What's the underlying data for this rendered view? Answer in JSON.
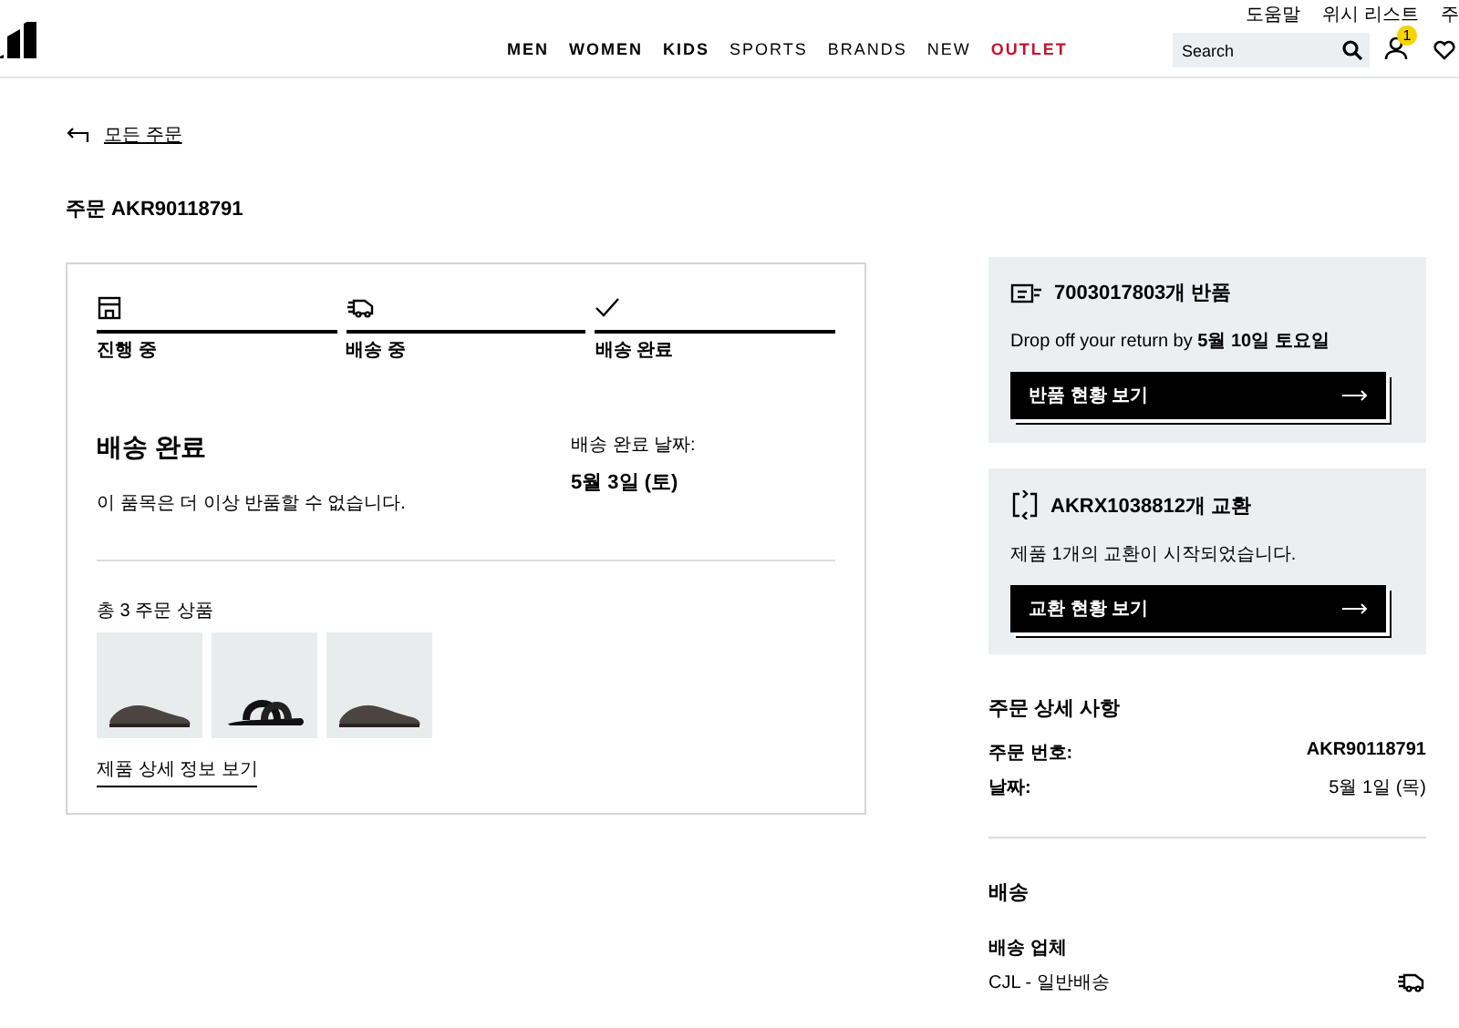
{
  "header": {
    "utility_links": [
      "도움말",
      "위시 리스트",
      "주"
    ],
    "nav": [
      {
        "label": "MEN",
        "kind": "bold"
      },
      {
        "label": "WOMEN",
        "kind": "bold"
      },
      {
        "label": "KIDS",
        "kind": "bold"
      },
      {
        "label": "SPORTS",
        "kind": "regular"
      },
      {
        "label": "BRANDS",
        "kind": "regular"
      },
      {
        "label": "NEW",
        "kind": "regular"
      },
      {
        "label": "OUTLET",
        "kind": "sale"
      }
    ],
    "search": {
      "placeholder": "Search"
    },
    "account_badge": "1"
  },
  "back_link": "모든 주문",
  "order_title": "주문 AKR90118791",
  "tracker": {
    "steps": [
      {
        "label": "진행 중",
        "completed": true
      },
      {
        "label": "배송 중",
        "completed": true
      },
      {
        "label": "배송 완료",
        "completed": true
      }
    ],
    "status": "배송 완료",
    "status_note": "이 품목은 더 이상 반품할 수 없습니다.",
    "date_label": "배송 완료 날짜:",
    "date": "5월 3일 (토)",
    "items_label": "총 3 주문 상품",
    "products": [
      {
        "kind": "sneaker"
      },
      {
        "kind": "slide"
      },
      {
        "kind": "sneaker"
      }
    ],
    "details_link": "제품 상세 정보 보기"
  },
  "panels": [
    {
      "title": "7003017803개 반품",
      "text": "Drop off your return by **5월 10일 토요일**",
      "button": "반품 현황 보기"
    },
    {
      "title": "AKRX1038812개 교환",
      "text": "제품 1개의 교환이 시작되었습니다.",
      "button": "교환 현황 보기"
    }
  ],
  "order_details": {
    "title": "주문 상세 사항",
    "rows": [
      {
        "label": "주문 번호:",
        "value": "AKR90118791"
      },
      {
        "label": "날짜:",
        "value": "5월 1일 (목)"
      }
    ]
  },
  "shipping": {
    "title": "배송",
    "carrier_label": "배송 업체",
    "carrier": "CJL - 일반배송"
  }
}
